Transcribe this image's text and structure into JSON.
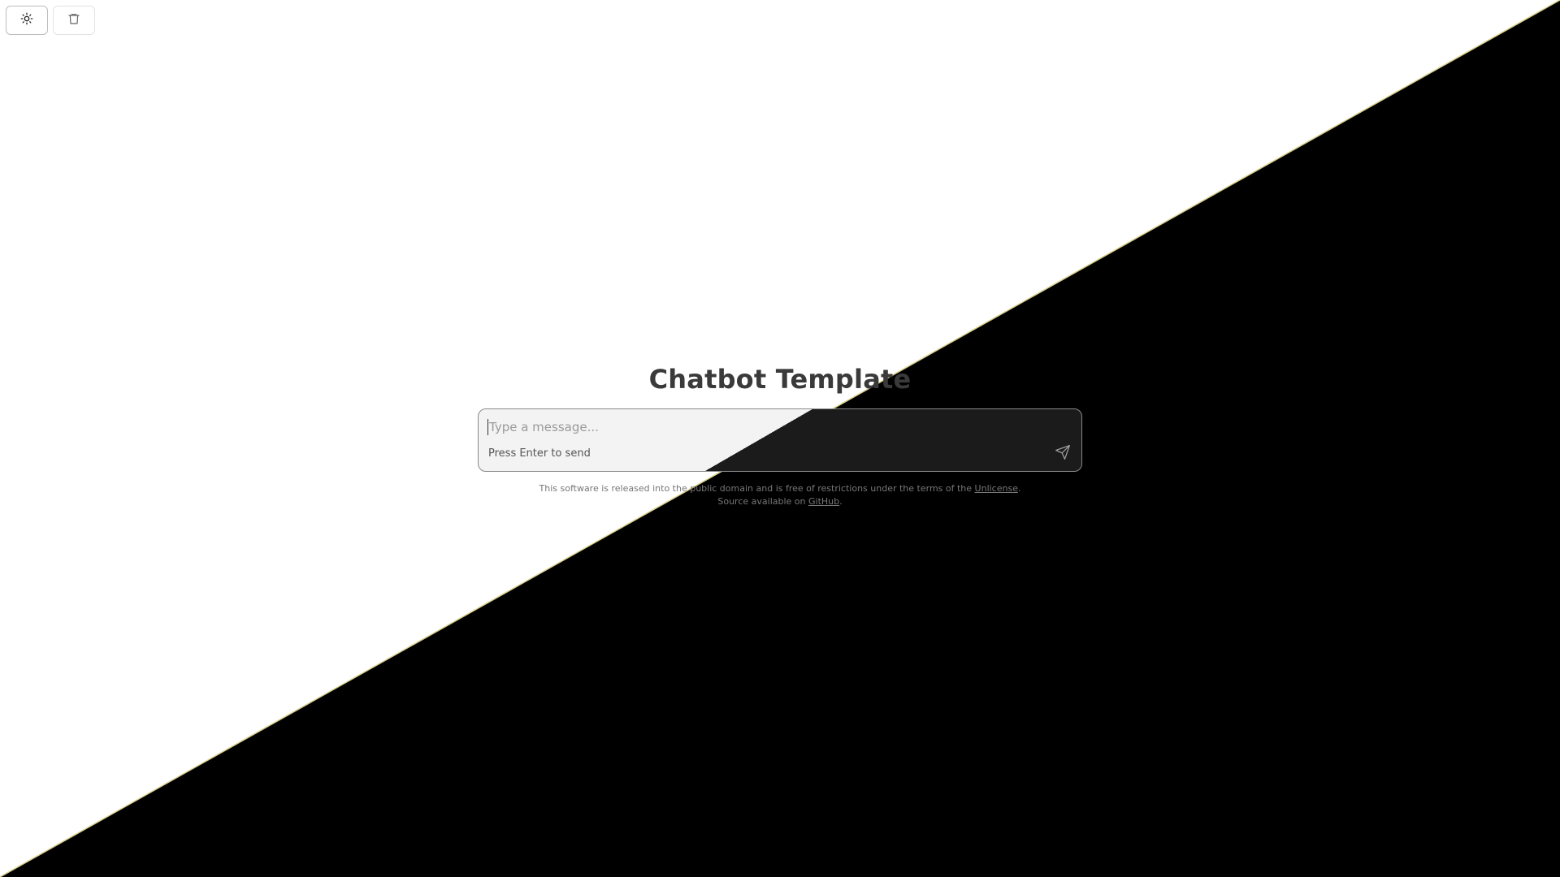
{
  "toolbar": {
    "theme_toggle_icon": "sun-icon",
    "clear_chat_icon": "trash-icon"
  },
  "main": {
    "title": "Chatbot Template"
  },
  "composer": {
    "placeholder": "Type a message...",
    "value": "",
    "hint": "Press Enter to send",
    "send_icon": "send-icon"
  },
  "footer": {
    "line1_text": "This software is released into the public domain and is free of restrictions under the terms of the ",
    "license_link": "Unlicense",
    "line1_end": ".",
    "line2_text": "Source available on ",
    "github_link": "GitHub",
    "line2_end": "."
  },
  "colors": {
    "light_background": "#ffffff",
    "dark_background": "#000000",
    "title_text": "#3a3a3a",
    "diagonal_edge": "#d8cf8a"
  }
}
